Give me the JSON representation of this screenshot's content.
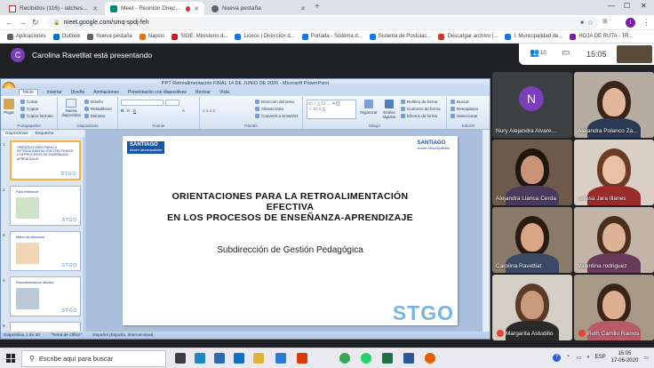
{
  "browser": {
    "tabs": [
      {
        "title": "Recibidos (116) - ialchesr@dem...",
        "color": "#d93025"
      },
      {
        "title": "Meet - Reunión Directores y ...",
        "color": "#00897b"
      },
      {
        "title": "Nueva pestaña",
        "color": "#5f6368"
      }
    ],
    "url": "meet.google.com/smq-spdj-feh",
    "bookmarks": [
      {
        "label": "Aplicaciones",
        "color": "#5f6368"
      },
      {
        "label": "Outlook",
        "color": "#0072c6"
      },
      {
        "label": "Nueva pestaña",
        "color": "#5f6368"
      },
      {
        "label": "Napsis",
        "color": "#e8710a"
      },
      {
        "label": "SIGE: Ministerio d...",
        "color": "#c5221f"
      },
      {
        "label": "Liceos | Dirección d...",
        "color": "#1a73e8"
      },
      {
        "label": "Portada - Sistema d...",
        "color": "#1a73e8"
      },
      {
        "label": "Sistema de Postulac...",
        "color": "#1a73e8"
      },
      {
        "label": "Descargar archivo |...",
        "color": "#d93025"
      },
      {
        "label": "I. Municipalidad de...",
        "color": "#1a73e8"
      },
      {
        "label": "HOJA DE RUTA - TR...",
        "color": "#7b1fa2"
      }
    ],
    "profile_initial": "I"
  },
  "meet": {
    "presenter_initial": "C",
    "presenter_text": "Carolina Ravetllat está presentando",
    "participant_count": "10",
    "time": "15:05",
    "participants": [
      {
        "name": "Nury Alejandra Alvare...",
        "avatar": "N"
      },
      {
        "name": "Alejandra Polanco Za..."
      },
      {
        "name": "Alejandra Llanca Cerda"
      },
      {
        "name": "Teresa Jara Illanes"
      },
      {
        "name": "Carolina Ravetllat"
      },
      {
        "name": "Valentina rodriguez"
      },
      {
        "name": "Margarita Astudillo",
        "muted": true
      },
      {
        "name": "Ruth Carrillo Ramos",
        "muted": true
      }
    ]
  },
  "ppt": {
    "title": "PPT Retroalimentación FINAL 14 DE JUNIO DE 2020 - Microsoft PowerPoint",
    "tabs": [
      "Inicio",
      "Insertar",
      "Diseño",
      "Animaciones",
      "Presentación con diapositivas",
      "Revisar",
      "Vista"
    ],
    "groups": [
      {
        "label": "Portapapeles",
        "items": [
          "Pegar",
          "Cortar",
          "Copiar",
          "Copiar formato"
        ]
      },
      {
        "label": "Diapositivas",
        "items": [
          "Nueva diapositiva",
          "Diseño",
          "Restablecer",
          "Eliminar"
        ]
      },
      {
        "label": "Fuente",
        "items": []
      },
      {
        "label": "Párrafo",
        "items": [
          "Dirección del texto",
          "Alinear texto",
          "Convertir a SmartArt"
        ]
      },
      {
        "label": "Dibujo",
        "items": [
          "Organizar",
          "Estilos rápidos",
          "Relleno de forma",
          "Contorno de forma",
          "Efectos de forma"
        ]
      },
      {
        "label": "Edición",
        "items": [
          "Buscar",
          "Reemplazar",
          "Seleccionar"
        ]
      }
    ],
    "left_tabs": [
      "Diapositivas",
      "Esquema"
    ],
    "slide": {
      "logo_main": "SANTIAGO",
      "logo_sub": "Ilustre Municipalidad",
      "title_lines": [
        "ORIENTACIONES PARA LA RETROALIMENTACIÓN",
        "EFECTIVA",
        "EN LOS PROCESOS DE ENSEÑANZA-APRENDIZAJE"
      ],
      "subtitle": "Subdirección de Gestión Pedagógica",
      "brand": "STGO"
    },
    "thumbnails": [
      {
        "num": "1",
        "text": "ORIENTACIONES PARA LA RETROALIMENTACIÓN EFECTIVA EN LOS PROCESOS DE ENSEÑANZA-APRENDIZAJE"
      },
      {
        "num": "2",
        "text": "Para reflexionar"
      },
      {
        "num": "3",
        "text": "Marco de referencia"
      },
      {
        "num": "4",
        "text": "Retroalimentación efectiva"
      },
      {
        "num": "5",
        "text": ""
      }
    ],
    "status": {
      "slide": "Diapositiva 1 de 30",
      "theme": "\"Tema de Office\"",
      "language": "Español (España, internacional)"
    }
  },
  "taskbar": {
    "search_placeholder": "Escribe aquí para buscar",
    "lang": "ESP",
    "time": "15:05",
    "date": "17-06-2020"
  }
}
